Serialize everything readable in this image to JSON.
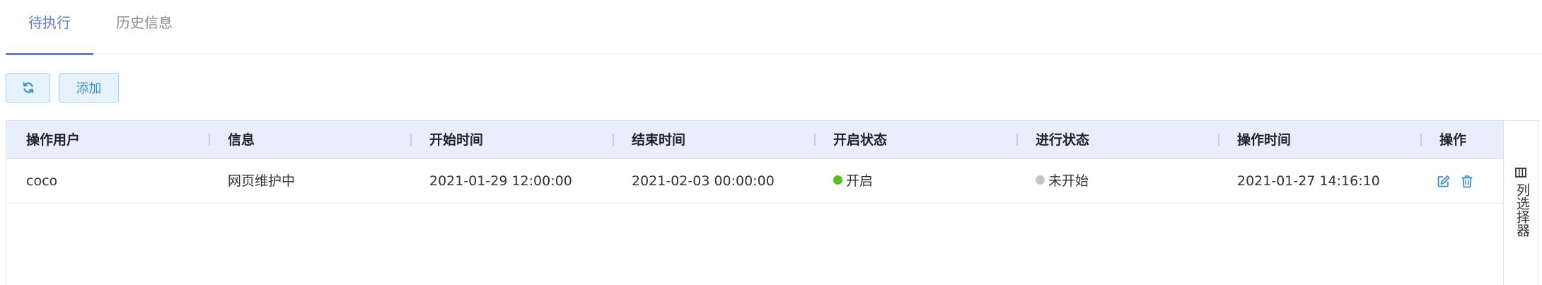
{
  "tabs": [
    {
      "label": "待执行",
      "active": true
    },
    {
      "label": "历史信息",
      "active": false
    }
  ],
  "toolbar": {
    "refresh_icon": "refresh-icon",
    "add_label": "添加"
  },
  "table": {
    "columns": [
      "操作用户",
      "信息",
      "开始时间",
      "结束时间",
      "开启状态",
      "进行状态",
      "操作时间",
      "操作"
    ],
    "rows": [
      {
        "user": "coco",
        "info": "网页维护中",
        "start_time": "2021-01-29 12:00:00",
        "end_time": "2021-02-03 00:00:00",
        "enable_status": "开启",
        "progress_status": "未开始",
        "operate_time": "2021-01-27 14:16:10"
      }
    ],
    "action_icons": [
      "edit-icon",
      "delete-icon"
    ]
  },
  "column_selector": {
    "label": "列选择器",
    "icon": "columns-icon"
  },
  "colors": {
    "accent": "#5b7ee6",
    "button_bg": "#e6f3fd",
    "button_border": "#a9d1f0",
    "header_bg": "#e9eefd",
    "status_on": "#52c41a",
    "status_idle": "#c0c4cc",
    "action_icon": "#3a8ee6"
  }
}
